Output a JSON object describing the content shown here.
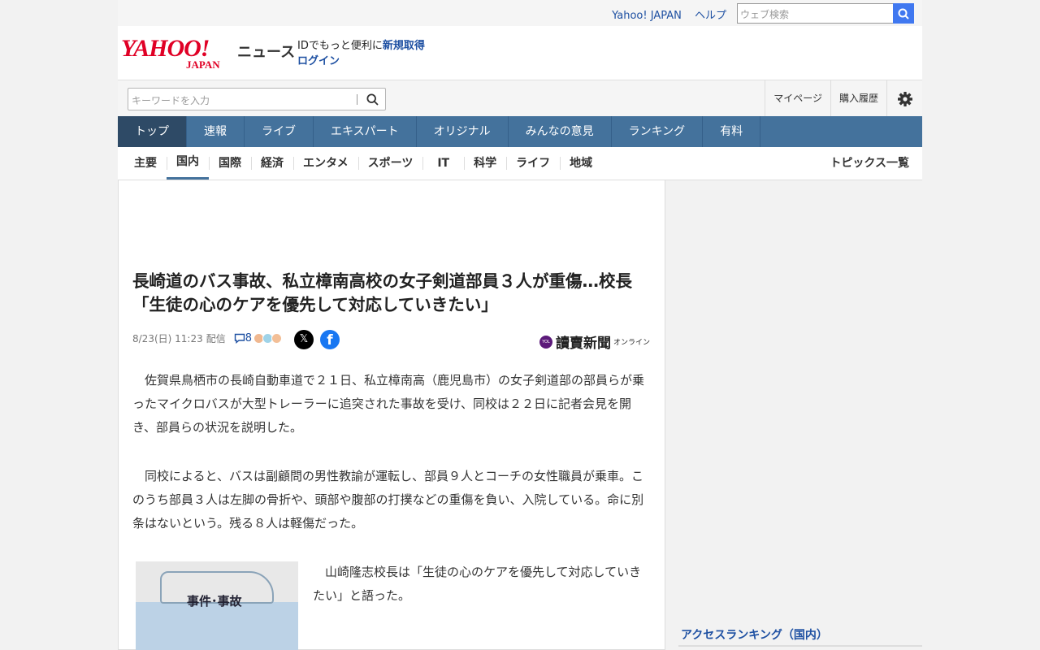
{
  "topbar": {
    "yahoo_link": "Yahoo! JAPAN",
    "help_link": "ヘルプ",
    "search_placeholder": "ウェブ検索"
  },
  "header": {
    "logo_main": "YAHOO!",
    "logo_sub": "JAPAN",
    "service": "ニュース",
    "id_text": "IDでもっと便利に",
    "register": "新規取得",
    "login": "ログイン"
  },
  "search": {
    "placeholder": "キーワードを入力",
    "my_page": "マイページ",
    "purchase_history": "購入履歴"
  },
  "nav": [
    "トップ",
    "速報",
    "ライブ",
    "エキスパート",
    "オリジナル",
    "みんなの意見",
    "ランキング",
    "有料"
  ],
  "subnav": [
    "主要",
    "国内",
    "国際",
    "経済",
    "エンタメ",
    "スポーツ",
    "IT",
    "科学",
    "ライフ",
    "地域"
  ],
  "subnav_topics": "トピックス一覧",
  "article": {
    "title": "長崎道のバス事故、私立樟南高校の女子剣道部員３人が重傷…校長「生徒の心のケアを優先して対応していきたい」",
    "date": "8/23(日) 11:23",
    "distribution": "配信",
    "comment_count": "8",
    "share_x": "𝕏",
    "share_fb": "f",
    "publisher_mark": "YOL",
    "publisher": "讀賣新聞",
    "publisher_sub": "オンライン",
    "p1": "　佐賀県鳥栖市の長崎自動車道で２１日、私立樟南高（鹿児島市）の女子剣道部の部員らが乗ったマイクロバスが大型トレーラーに追突された事故を受け、同校は２２日に記者会見を開き、部員らの状況を説明した。",
    "p2": "　同校によると、バスは副顧問の男性教諭が運転し、部員９人とコーチの女性職員が乗車。このうち部員３人は左脚の骨折や、頭部や腹部の打撲などの重傷を負い、入院している。命に別条はないという。残る８人は軽傷だった。",
    "p3": "　山崎隆志校長は「生徒の心のケアを優先して対応していきたい」と語った。",
    "photo_label": "事件･事故"
  },
  "sidebar": {
    "ranking_title": "アクセスランキング（国内）"
  }
}
